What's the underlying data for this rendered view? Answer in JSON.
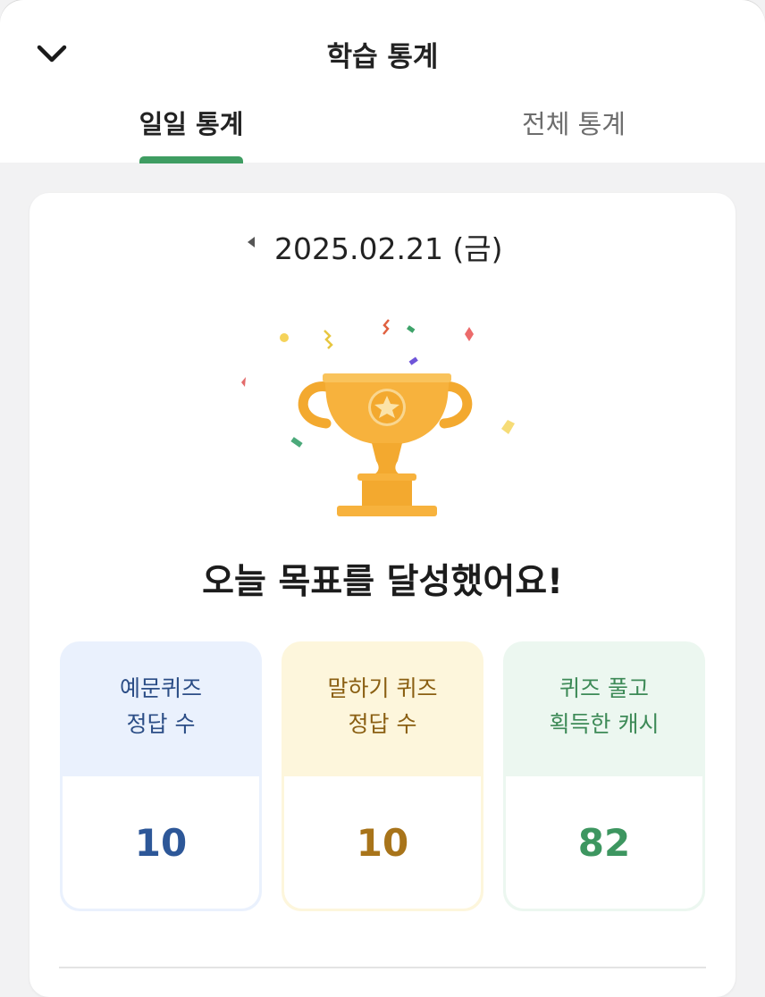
{
  "header": {
    "title": "학습 통계"
  },
  "tabs": [
    {
      "label": "일일 통계",
      "active": true
    },
    {
      "label": "전체 통계",
      "active": false
    }
  ],
  "date": {
    "text": "2025.02.21 (금)"
  },
  "headline": "오늘 목표를 달성했어요!",
  "stats": [
    {
      "label": "예문퀴즈\n정답 수",
      "value": "10",
      "color": "#2d5798"
    },
    {
      "label": "말하기 퀴즈\n정답 수",
      "value": "10",
      "color": "#a8741a"
    },
    {
      "label": "퀴즈 풀고\n획득한 캐시",
      "value": "82",
      "color": "#3d9660"
    }
  ],
  "colors": {
    "accent": "#3f9d62",
    "trophy": "#f7b23d"
  },
  "icons": {
    "back": "chevron-down-icon",
    "prev_date": "caret-left-icon",
    "trophy": "trophy-icon"
  }
}
